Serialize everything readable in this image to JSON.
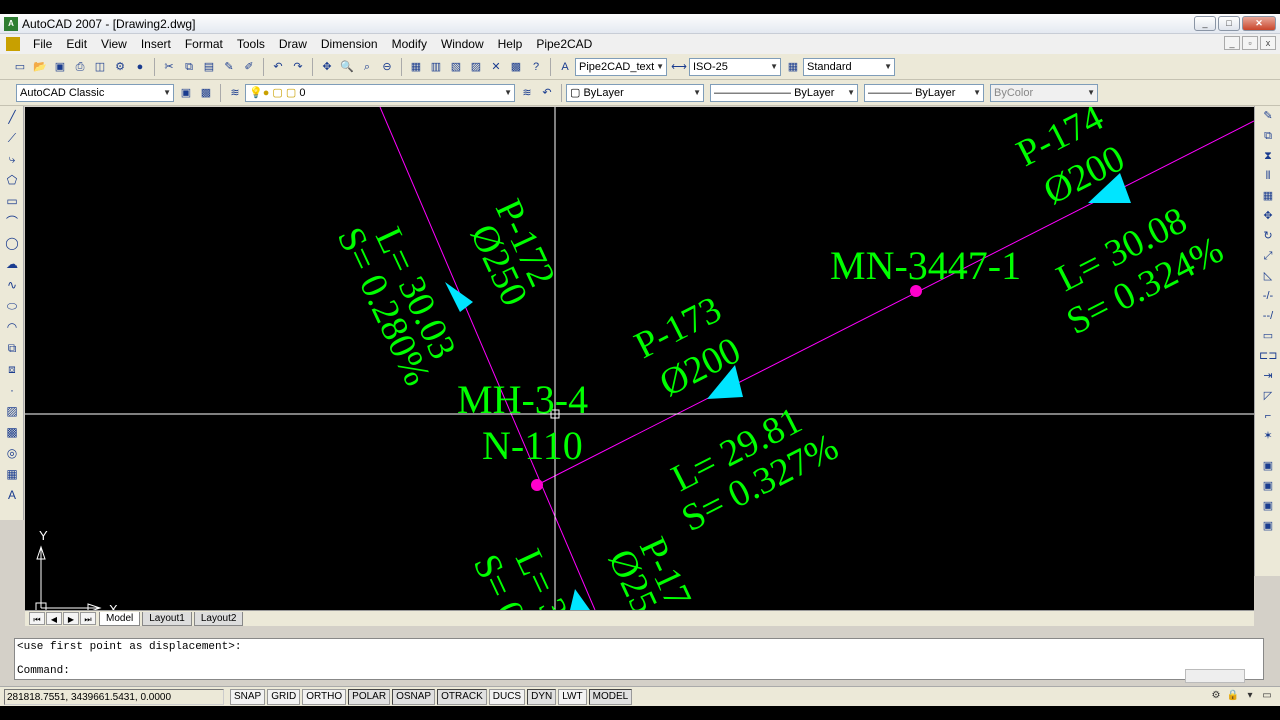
{
  "window": {
    "title": "AutoCAD 2007 - [Drawing2.dwg]",
    "app_icon": "AutoCAD",
    "minimize": "_",
    "restore": "□",
    "close": "✕"
  },
  "menu": {
    "items": [
      "File",
      "Edit",
      "View",
      "Insert",
      "Format",
      "Tools",
      "Draw",
      "Dimension",
      "Modify",
      "Window",
      "Help",
      "Pipe2CAD"
    ]
  },
  "toolbar1": {
    "text_style": "Pipe2CAD_text",
    "dim_style": "ISO-25",
    "table_style": "Standard"
  },
  "toolbar2": {
    "workspace": "AutoCAD Classic",
    "layer": "0",
    "color": "ByLayer",
    "linetype": "ByLayer",
    "lineweight": "ByLayer",
    "plotstyle": "ByColor"
  },
  "drawing": {
    "labels": {
      "p172": "P-172",
      "p172_dia": "Ø250",
      "p172_len": "L= 30.03",
      "p172_slope": "S= 0.280%",
      "mh34": "MH-3-4",
      "n110": "N-110",
      "p173": "P-173",
      "p173_dia": "Ø200",
      "p173_len": "L= 29.81",
      "p173_slope": "S= 0.327%",
      "mh_overlap": "MN-3447-1",
      "p174": "P-174",
      "p174_dia": "Ø200",
      "p174_len": "L= 30.08",
      "p174_slope": "S= 0.324%",
      "bottom_p": "P-17",
      "bottom_dia": "Ø25",
      "bottom_len": "L= 3",
      "bottom_slope": "S= 0",
      "ucs_x": "X",
      "ucs_y": "Y"
    },
    "colors": {
      "text": "#00ff00",
      "pipe": "#ff00ff",
      "node": "#ff00cc",
      "arrow": "#00e5ff",
      "crosshair": "#ffffff"
    }
  },
  "tabs": {
    "model": "Model",
    "layout1": "Layout1",
    "layout2": "Layout2"
  },
  "command": {
    "history": "<use first point as displacement>:",
    "prompt": "Command:"
  },
  "status": {
    "coords": "281818.7551, 3439661.5431, 0.0000",
    "buttons": [
      "SNAP",
      "GRID",
      "ORTHO",
      "POLAR",
      "OSNAP",
      "OTRACK",
      "DUCS",
      "DYN",
      "LWT",
      "MODEL"
    ]
  }
}
